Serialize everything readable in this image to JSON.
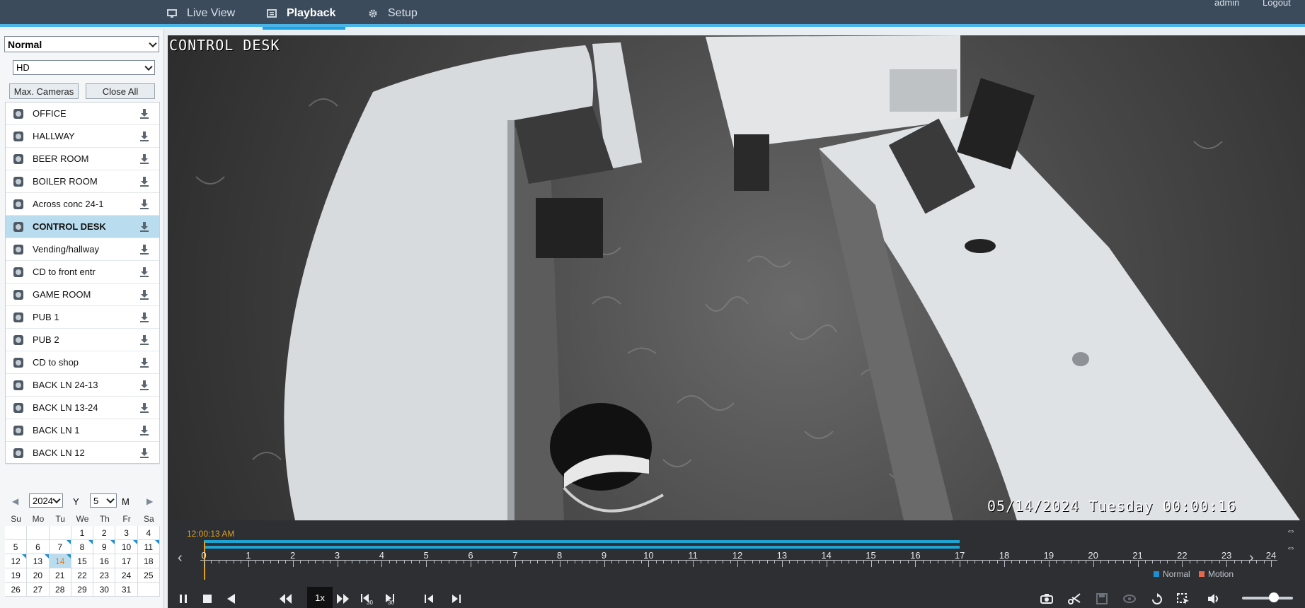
{
  "nav": {
    "items": [
      {
        "label": "Live View",
        "icon": "monitor-icon"
      },
      {
        "label": "Playback",
        "icon": "playback-icon"
      },
      {
        "label": "Setup",
        "icon": "gear-icon"
      }
    ],
    "active": "Playback",
    "user": "admin",
    "logout": "Logout"
  },
  "sidebar": {
    "mode_select": "Normal",
    "quality_select": "HD",
    "max_cameras_label": "Max. Cameras",
    "close_all_label": "Close All",
    "cameras": [
      "OFFICE",
      "HALLWAY",
      "BEER ROOM",
      "BOILER ROOM",
      "Across conc 24-1",
      "CONTROL DESK",
      "Vending/hallway",
      "CD to front entr",
      "GAME ROOM",
      "PUB 1",
      "PUB 2",
      "CD to shop",
      "BACK LN 24-13",
      "BACK LN 13-24",
      "BACK LN 1",
      "BACK LN 12"
    ],
    "active_camera": "CONTROL DESK"
  },
  "calendar": {
    "year": "2024",
    "year_label": "Y",
    "month": "5",
    "month_label": "M",
    "weekdays": [
      "Su",
      "Mo",
      "Tu",
      "We",
      "Th",
      "Fr",
      "Sa"
    ],
    "weeks": [
      [
        "",
        "",
        "",
        "1",
        "2",
        "3",
        "4"
      ],
      [
        "5",
        "6",
        "7",
        "8",
        "9",
        "10",
        "11"
      ],
      [
        "12",
        "13",
        "14",
        "15",
        "16",
        "17",
        "18"
      ],
      [
        "19",
        "20",
        "21",
        "22",
        "23",
        "24",
        "25"
      ],
      [
        "26",
        "27",
        "28",
        "29",
        "30",
        "31",
        ""
      ]
    ],
    "today": "14",
    "recorded_days": [
      "7",
      "8",
      "9",
      "10",
      "11",
      "12",
      "13",
      "14"
    ]
  },
  "video": {
    "camera_title": "CONTROL DESK",
    "timestamp": "05/14/2024 Tuesday 00:00:16"
  },
  "timeline": {
    "current_time": "12:00:13 AM",
    "hours": [
      "0",
      "1",
      "2",
      "3",
      "4",
      "5",
      "6",
      "7",
      "8",
      "9",
      "10",
      "11",
      "12",
      "13",
      "14",
      "15",
      "16",
      "17",
      "18",
      "19",
      "20",
      "21",
      "22",
      "23",
      "24"
    ],
    "recorded_until_hour": 17,
    "legend": [
      {
        "label": "Normal",
        "color": "#1f8fd0"
      },
      {
        "label": "Motion",
        "color": "#e8664a"
      }
    ],
    "speed": "1x",
    "volume": 0.5
  },
  "colors": {
    "accent": "#1fa2e0",
    "topbar": "#3c4b5b",
    "recording": "#1ea3d3",
    "cursor": "#e0a020"
  }
}
